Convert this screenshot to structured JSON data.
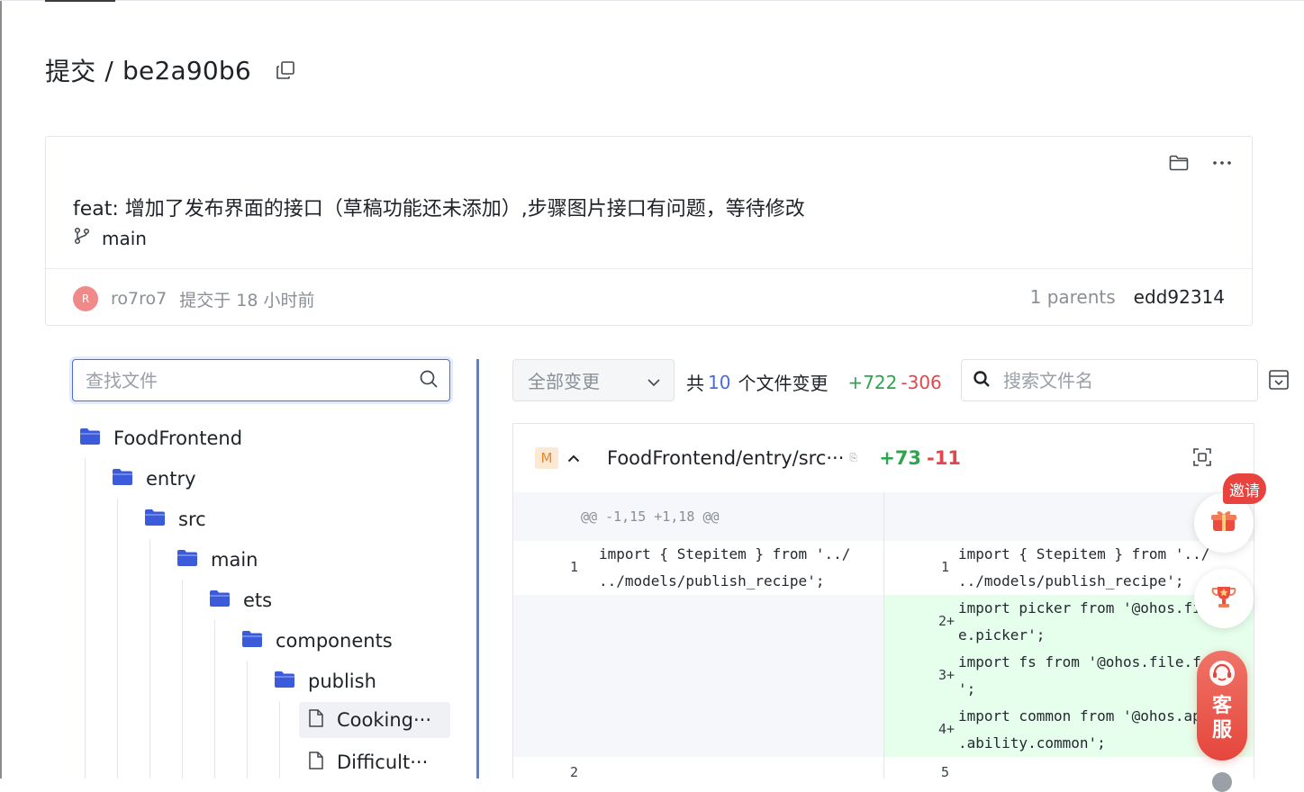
{
  "page": {
    "title_prefix": "提交",
    "separator": "/",
    "commit_short": "be2a90b6"
  },
  "commit": {
    "message": "feat: 增加了发布界面的接口（草稿功能还未添加）,步骤图片接口有问题，等待修改",
    "branch": "main",
    "author_initial": "R",
    "author": "ro7ro7",
    "committed_time": "提交于 18 小时前",
    "parents_label": "1 parents",
    "parent_hash": "edd92314"
  },
  "file_tree": {
    "search_placeholder": "查找文件",
    "items": [
      {
        "label": "FoodFrontend",
        "type": "folder"
      },
      {
        "label": "entry",
        "type": "folder"
      },
      {
        "label": "src",
        "type": "folder"
      },
      {
        "label": "main",
        "type": "folder"
      },
      {
        "label": "ets",
        "type": "folder"
      },
      {
        "label": "components",
        "type": "folder"
      },
      {
        "label": "publish",
        "type": "folder"
      },
      {
        "label": "Cooking···",
        "type": "file",
        "selected": true
      },
      {
        "label": "Difficult···",
        "type": "file"
      }
    ]
  },
  "diff_toolbar": {
    "filter_label": "全部变更",
    "summary_prefix": "共",
    "files_count": "10",
    "summary_suffix": "个文件变更",
    "additions": "+722",
    "deletions": "-306",
    "search_placeholder": "搜索文件名"
  },
  "diff_file": {
    "status_badge": "M",
    "path": "FoodFrontend/entry/src···",
    "copy_hint": "⎘",
    "additions": "+73",
    "deletions": "-11",
    "hunk_header": "@@ -1,15 +1,18 @@",
    "lines": {
      "l1_num": "1",
      "l1_code": "import { Stepitem } from '../\n../models/publish_recipe';",
      "r1_num": "1",
      "r1_code": "import { Stepitem } from '../\n../models/publish_recipe';",
      "r2_num": "2+",
      "r2_code": "import picker from '@ohos.fil\ne.picker';",
      "r3_num": "3+",
      "r3_code": "import fs from '@ohos.file.fs\n';",
      "r4_num": "4+",
      "r4_code": "import common from '@ohos.app\n.ability.common';",
      "l5_num": "2",
      "r5_num": "5"
    }
  },
  "floating": {
    "invite_label": "邀请",
    "service_label_1": "客",
    "service_label_2": "服"
  },
  "colors": {
    "accent": "#4d6bd9",
    "added_bg": "#e6ffec",
    "added_text": "#2da44e",
    "deleted_text": "#e3474e",
    "folder": "#3b5bdb",
    "service": "#e5463c"
  }
}
